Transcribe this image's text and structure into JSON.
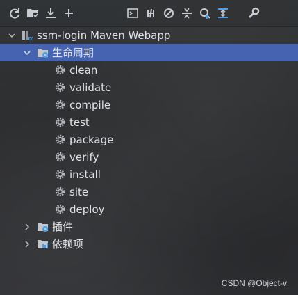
{
  "toolbar": {
    "buttons": [
      {
        "icon": "refresh-icon"
      },
      {
        "icon": "add-project-icon"
      },
      {
        "icon": "download-icon"
      },
      {
        "icon": "plus-icon"
      },
      {
        "icon": "run-goal-icon"
      },
      {
        "icon": "toggle-offline-icon"
      },
      {
        "icon": "skip-tests-icon"
      },
      {
        "icon": "collapse-icon"
      },
      {
        "icon": "analyze-dependencies-icon"
      },
      {
        "icon": "show-dependencies-icon"
      },
      {
        "icon": "settings-wrench-icon"
      }
    ]
  },
  "tree": {
    "project": {
      "label": "ssm-login Maven Webapp"
    },
    "lifecycle": {
      "label": "生命周期",
      "phases": [
        "clean",
        "validate",
        "compile",
        "test",
        "package",
        "verify",
        "install",
        "site",
        "deploy"
      ]
    },
    "plugins": {
      "label": "插件"
    },
    "dependencies": {
      "label": "依赖项"
    }
  },
  "watermark": "CSDN @Object-v",
  "colors": {
    "background": "#2b2d30",
    "selection": "#4563b0",
    "icon_blue": "#4a9ee8",
    "text": "#dfe3e8"
  }
}
